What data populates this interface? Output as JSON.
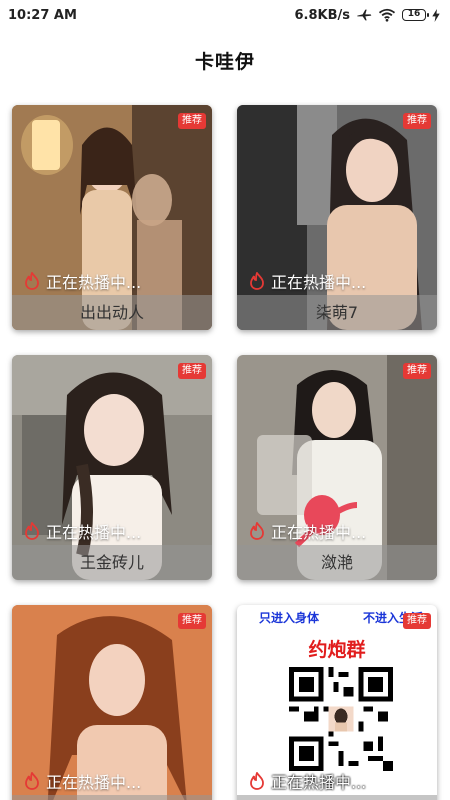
{
  "status_bar": {
    "time": "10:27 AM",
    "speed": "6.8KB/s",
    "battery": "16"
  },
  "header": {
    "title": "卡哇伊"
  },
  "cards": [
    {
      "name": "出出动人",
      "badge": "推荐",
      "live_text": "正在热播中..."
    },
    {
      "name": "柒萌7",
      "badge": "推荐",
      "live_text": "正在热播中..."
    },
    {
      "name": "王金砖儿",
      "badge": "推荐",
      "live_text": "正在热播中..."
    },
    {
      "name": "潋滟",
      "badge": "推荐",
      "live_text": "正在热播中..."
    },
    {
      "name": "",
      "badge": "推荐",
      "live_text": "正在热播中..."
    },
    {
      "name": "",
      "badge": "推荐",
      "live_text": "正在热播中...",
      "ad_left": "只进入身体",
      "ad_right": "不进入生活",
      "ad_title": "约炮群"
    }
  ],
  "colors": {
    "badge": "#e53935",
    "ad_blue": "#1b36d8",
    "ad_red": "#e11d1d"
  },
  "icons": [
    "airplane-icon",
    "wifi-icon",
    "battery-icon",
    "charging-icon",
    "fire-icon"
  ]
}
